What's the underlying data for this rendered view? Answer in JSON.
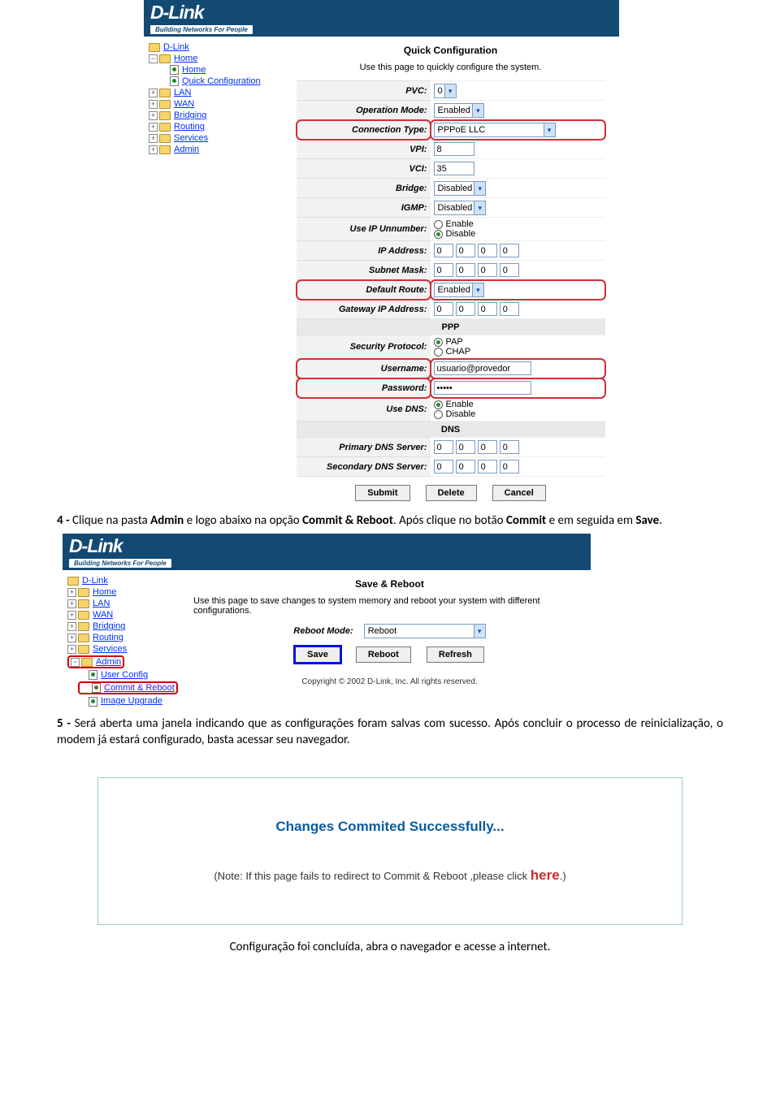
{
  "banner": {
    "brand": "D-Link",
    "tag": "Building Networks For People"
  },
  "doc": {
    "p4": "4 - Clique na pasta Admin e logo abaixo na opção Commit & Reboot. Após clique no botão Commit e em seguida em Save.",
    "p5": "5 - Será aberta uma janela indicando que as configurações foram salvas com sucesso. Após concluir o processo de reinicialização, o modem já estará configurado, basta acessar seu navegador.",
    "foot": "Configuração foi concluída, abra o navegador e acesse a internet."
  },
  "nav1": {
    "root": "D-Link",
    "items": [
      "Home",
      "Home",
      "Quick Configuration",
      "LAN",
      "WAN",
      "Bridging",
      "Routing",
      "Services",
      "Admin"
    ]
  },
  "nav2": {
    "root": "D-Link",
    "items": [
      "Home",
      "LAN",
      "WAN",
      "Bridging",
      "Routing",
      "Services",
      "Admin",
      "User Config",
      "Commit & Reboot",
      "Image Upgrade"
    ]
  },
  "quick": {
    "title": "Quick Configuration",
    "desc": "Use this page to quickly configure the system.",
    "labels": {
      "pvc": "PVC:",
      "op": "Operation Mode:",
      "ct": "Connection Type:",
      "vpi": "VPI:",
      "vci": "VCI:",
      "bridge": "Bridge:",
      "igmp": "IGMP:",
      "ipun": "Use IP Unnumber:",
      "ip": "IP Address:",
      "mask": "Subnet Mask:",
      "droute": "Default Route:",
      "gw": "Gateway IP Address:",
      "ppp": "PPP",
      "secp": "Security Protocol:",
      "user": "Username:",
      "pass": "Password:",
      "usedns": "Use DNS:",
      "dns": "DNS",
      "pdns": "Primary DNS Server:",
      "sdns": "Secondary DNS Server:"
    },
    "values": {
      "pvc": "0",
      "op": "Enabled",
      "ct": "PPPoE LLC",
      "vpi": "8",
      "vci": "35",
      "bridge": "Disabled",
      "igmp": "Disabled",
      "ip": [
        "0",
        "0",
        "0",
        "0"
      ],
      "mask": [
        "0",
        "0",
        "0",
        "0"
      ],
      "droute": "Enabled",
      "gw": [
        "0",
        "0",
        "0",
        "0"
      ],
      "user": "usuario@provedor",
      "pass": "•••••",
      "pdns": [
        "0",
        "0",
        "0",
        "0"
      ],
      "sdns": [
        "0",
        "0",
        "0",
        "0"
      ]
    },
    "radios": {
      "enable": "Enable",
      "disable": "Disable",
      "pap": "PAP",
      "chap": "CHAP"
    },
    "buttons": {
      "submit": "Submit",
      "delete": "Delete",
      "cancel": "Cancel"
    }
  },
  "save": {
    "title": "Save & Reboot",
    "desc": "Use this page to save changes to system memory and reboot your system with different configurations.",
    "label": "Reboot Mode:",
    "value": "Reboot",
    "buttons": {
      "save": "Save",
      "reboot": "Reboot",
      "refresh": "Refresh"
    },
    "copyright": "Copyright © 2002 D-Link, Inc. All rights reserved."
  },
  "commit": {
    "title": "Changes Commited Successfully...",
    "note_a": "(Note: If this page fails to redirect to Commit & Reboot ,please click ",
    "here": "here",
    "note_b": ".)"
  }
}
